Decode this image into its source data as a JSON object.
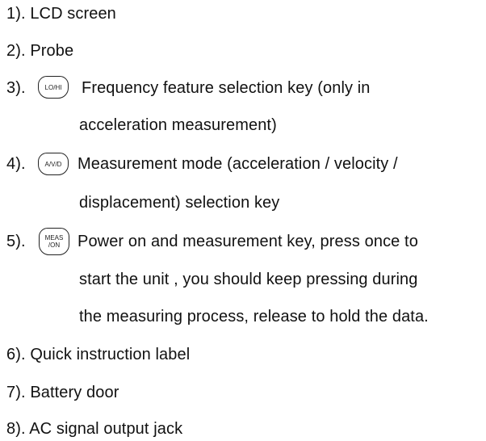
{
  "items": [
    {
      "num": "1).",
      "text": "LCD screen"
    },
    {
      "num": "2).",
      "text": "Probe"
    },
    {
      "num": "3).",
      "key": "LO/HI",
      "lines": [
        "Frequency feature selection key (only in",
        "acceleration measurement)"
      ]
    },
    {
      "num": "4).",
      "key": "A/V/D",
      "lines": [
        "Measurement mode (acceleration / velocity /",
        "displacement) selection key"
      ]
    },
    {
      "num": "5).",
      "key_line1": "MEAS",
      "key_line2": "/ON",
      "lines": [
        "Power on and measurement key, press once to",
        "start the unit , you should keep pressing during",
        "the measuring process, release to hold the data."
      ]
    },
    {
      "num": "6).",
      "text": "Quick instruction label"
    },
    {
      "num": "7).",
      "text": "Battery door"
    },
    {
      "num": "8).",
      "text": "AC signal output jack"
    }
  ]
}
